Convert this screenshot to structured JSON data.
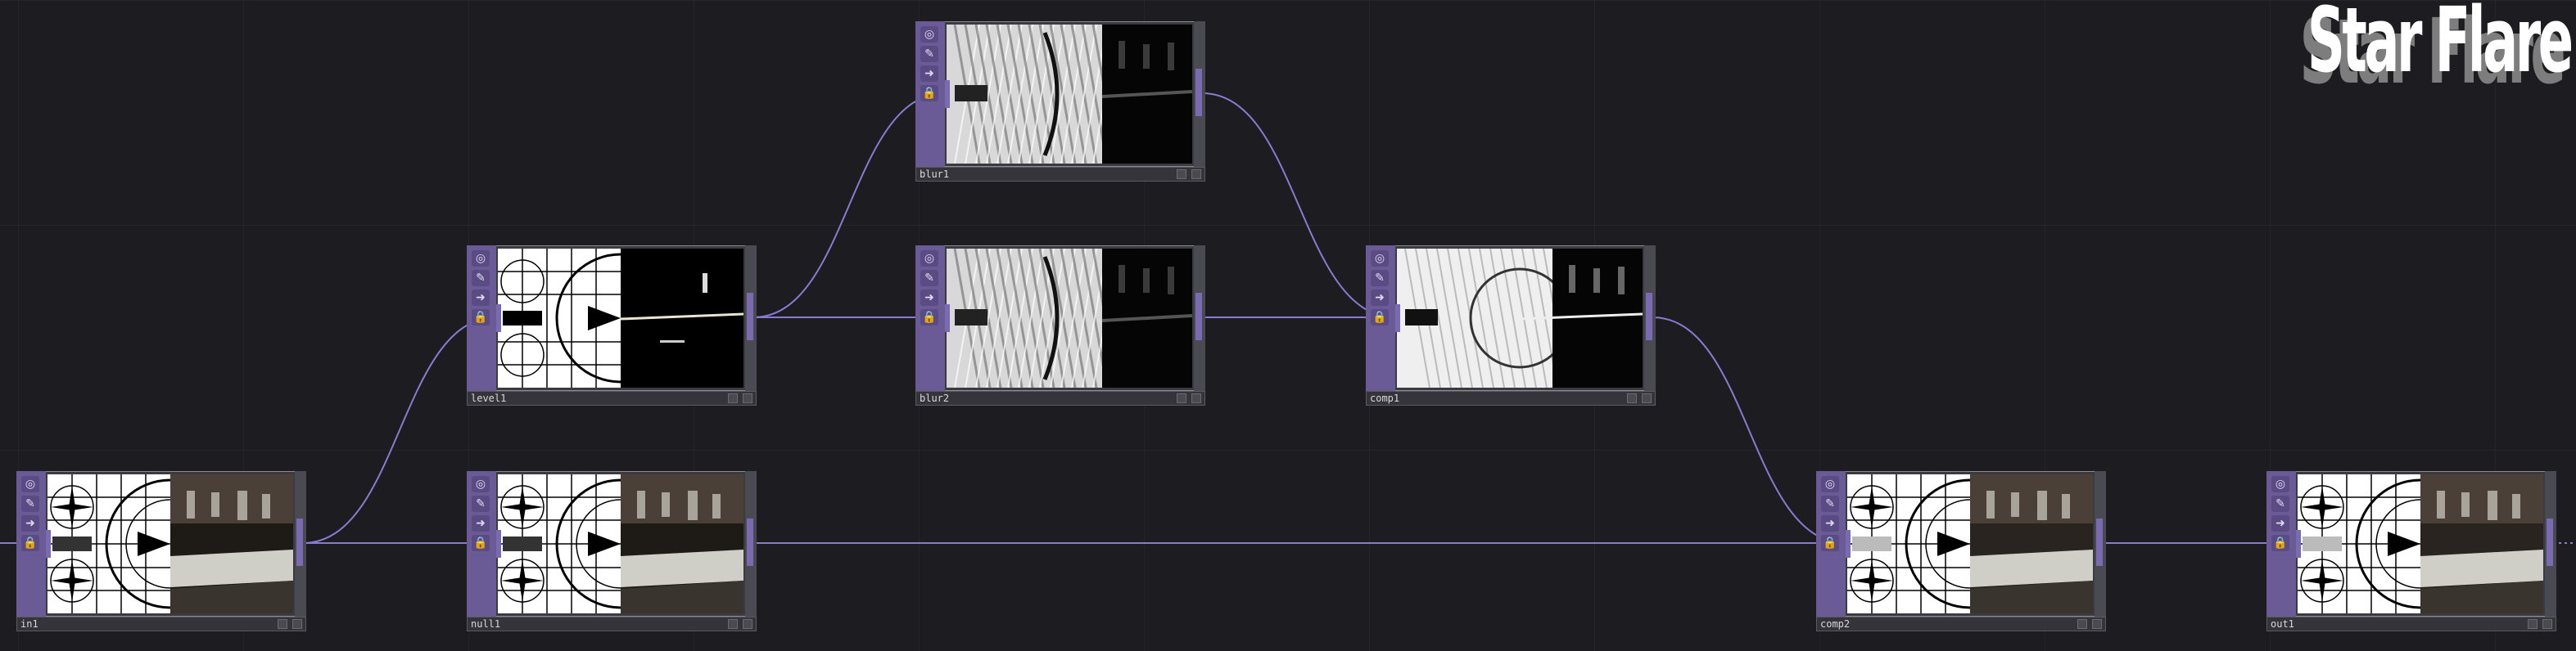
{
  "title": "Star Flare",
  "node_buttons": [
    {
      "icon": "viewer-icon",
      "glyph": "◎"
    },
    {
      "icon": "edit-icon",
      "glyph": "✎"
    },
    {
      "icon": "arrow-icon",
      "glyph": "➜"
    },
    {
      "icon": "lock-icon",
      "glyph": "🔒"
    }
  ],
  "nodes": [
    {
      "id": "in1",
      "name": "in1",
      "preview": "testcard"
    },
    {
      "id": "null1",
      "name": "null1",
      "preview": "testcard"
    },
    {
      "id": "level1",
      "name": "level1",
      "preview": "level"
    },
    {
      "id": "blur1",
      "name": "blur1",
      "preview": "blur"
    },
    {
      "id": "blur2",
      "name": "blur2",
      "preview": "blur"
    },
    {
      "id": "comp1",
      "name": "comp1",
      "preview": "comp"
    },
    {
      "id": "comp2",
      "name": "comp2",
      "preview": "testcard-light"
    },
    {
      "id": "out1",
      "name": "out1",
      "preview": "testcard-light"
    }
  ],
  "wires": [
    {
      "from": "in1",
      "to": "level1"
    },
    {
      "from": "in1",
      "to": "null1"
    },
    {
      "from": "level1",
      "to": "blur1"
    },
    {
      "from": "level1",
      "to": "blur2"
    },
    {
      "from": "blur1",
      "to": "comp1"
    },
    {
      "from": "blur2",
      "to": "comp1"
    },
    {
      "from": "null1",
      "to": "comp2"
    },
    {
      "from": "comp1",
      "to": "comp2"
    },
    {
      "from": "comp2",
      "to": "out1"
    }
  ],
  "colors": {
    "wire": "#8a7bd0",
    "node_side": "#6a5a96",
    "background": "#1c1c21"
  }
}
